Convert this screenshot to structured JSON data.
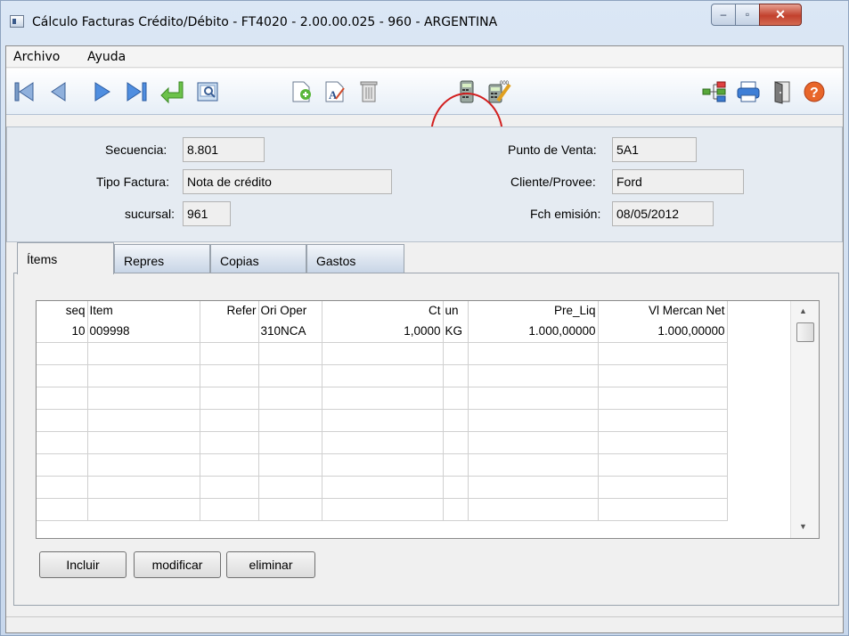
{
  "window": {
    "title": "Cálculo Facturas Crédito/Débito - FT4020 - 2.00.00.025 - 960 - ARGENTINA",
    "minimize_glyph": "–",
    "maximize_glyph": "▫",
    "close_glyph": "✕"
  },
  "menu": [
    "Archivo",
    "Ayuda"
  ],
  "toolbar": {
    "icons": [
      "first-record-icon",
      "prev-record-icon",
      "next-record-icon",
      "last-record-icon",
      "return-icon",
      "preview-icon",
      "new-record-icon",
      "edit-record-icon",
      "delete-record-icon",
      "calculator-icon",
      "calculate-edit-icon",
      "tree-icon",
      "print-icon",
      "exit-icon",
      "help-icon"
    ],
    "annotation_color": "#d21f1f"
  },
  "header": {
    "secuencia_label": "Secuencia:",
    "secuencia_value": "8.801",
    "tipo_factura_label": "Tipo Factura:",
    "tipo_factura_value": "Nota de crédito",
    "sucursal_label": "sucursal:",
    "sucursal_value": "961",
    "punto_venta_label": "Punto de Venta:",
    "punto_venta_value": "5A1",
    "cliente_label": "Cliente/Provee:",
    "cliente_value": "Ford",
    "fch_emision_label": "Fch emisión:",
    "fch_emision_value": "08/05/2012"
  },
  "tabs": [
    "Ítems",
    "Repres",
    "Copias",
    "Gastos"
  ],
  "grid": {
    "columns": [
      "seq",
      "Item",
      "Refer",
      "Ori Oper",
      "Ct",
      "un",
      "Pre_Liq",
      "Vl Mercan Net"
    ],
    "rows": [
      [
        "10",
        "009998",
        "",
        "310NCA",
        "1,0000",
        "KG",
        "1.000,00000",
        "1.000,00000"
      ]
    ],
    "scroll_up": "▲",
    "scroll_down": "▼"
  },
  "buttons": {
    "incluir": "Incluir",
    "modificar": "modificar",
    "eliminar": "eliminar"
  }
}
